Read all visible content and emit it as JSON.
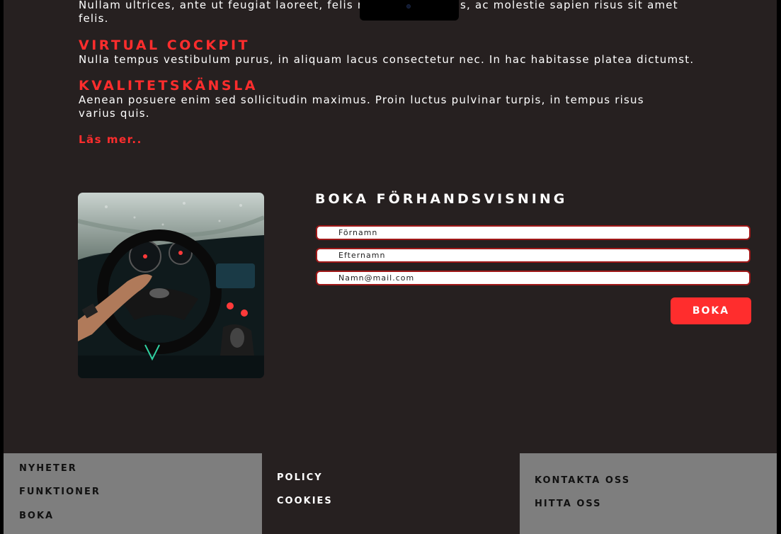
{
  "features": {
    "intro_text": "Nullam ultrices, ante ut feugiat laoreet, felis nisl tempus tellus, ac molestie sapien risus sit amet felis.",
    "items": [
      {
        "title": "Virtual cockpit",
        "text": "Nulla tempus vestibulum purus, in aliquam lacus consectetur nec. In hac habitasse platea dictumst."
      },
      {
        "title": "Kvalitetskänsla",
        "text": "Aenean posuere enim sed sollicitudin maximus. Proin luctus pulvinar turpis, in tempus risus varius quis."
      }
    ],
    "read_more": "Läs mer.."
  },
  "booking": {
    "title": "Boka förhandsvisning",
    "first_name_placeholder": "Förnamn",
    "last_name_placeholder": "Efternamn",
    "email_placeholder": "Namn@mail.com",
    "submit_label": "Boka"
  },
  "footer": {
    "col1": [
      "Nyheter",
      "Funktioner",
      "Boka"
    ],
    "col2": [
      "Policy",
      "Cookies"
    ],
    "col3": [
      "Kontakta oss",
      "Hitta oss"
    ]
  },
  "colors": {
    "accent": "#ff2d2d",
    "background": "#262020",
    "footer_grey": "#7e7e7e"
  }
}
